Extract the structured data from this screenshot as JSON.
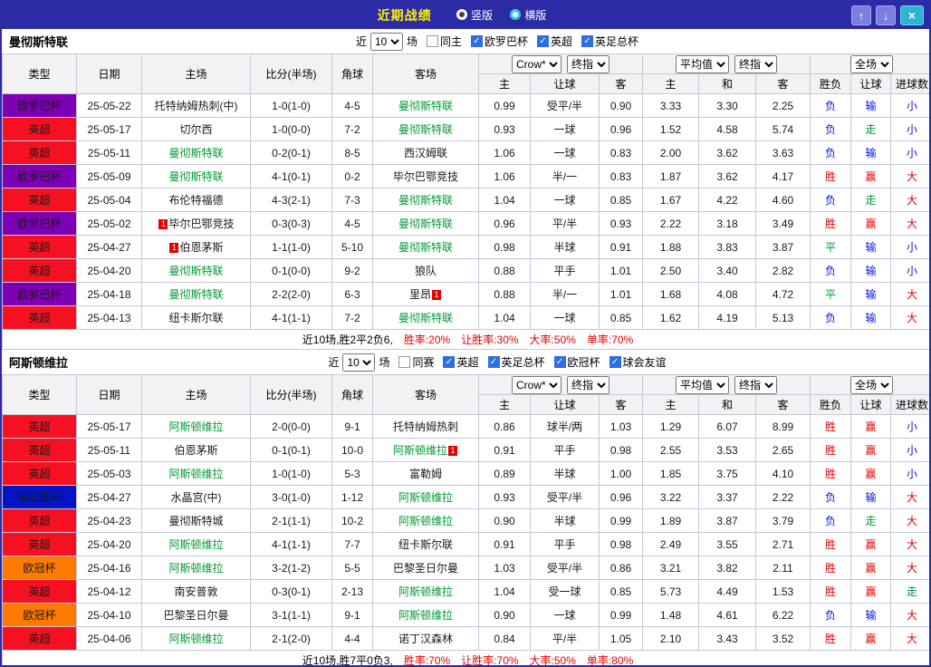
{
  "titlebar": {
    "title": "近期战绩",
    "vertical_label": "竖版",
    "horizontal_label": "横版",
    "up_icon": "↑",
    "down_icon": "↓",
    "close_icon": "×"
  },
  "filter_labels": {
    "near": "近",
    "games": "场"
  },
  "table_header": {
    "type": "类型",
    "date": "日期",
    "home": "主场",
    "score": "比分(半场)",
    "corner": "角球",
    "away": "客场",
    "odds1_select": "Crow*",
    "odds1_stage": "终指",
    "odds2_select": "平均值",
    "odds2_stage": "终指",
    "fulltime_select": "全场",
    "sub": [
      "主",
      "让球",
      "客",
      "主",
      "和",
      "客",
      "胜负",
      "让球",
      "进球数"
    ]
  },
  "colors": {
    "titlebar_bg": "#2b2ba6",
    "titlebar_title": "#ffef00",
    "nav_button": "#7d7de0",
    "close_button": "#2fb3cf",
    "checkbox_checked": "#2b6fe0",
    "grid_border": "#c6c6de",
    "header_bg": "#f2f2f2",
    "focal_team": "#009933",
    "score": "#dd2200",
    "type_map": {
      "欧罗巴杯": "#7d00b5",
      "英超": "#f51122",
      "英足总杯": "#0014c3",
      "欧冠杯": "#ff7a00"
    },
    "result_map": {
      "胜": "#e60000",
      "赢": "#e60000",
      "大": "#e60000",
      "负": "#0012e6",
      "输": "#0012e6",
      "小": "#0012e6",
      "平": "#009933",
      "走": "#009933"
    }
  },
  "sections": [
    {
      "team": "曼彻斯特联",
      "count": "10",
      "filters": [
        {
          "label": "同主",
          "checked": false
        },
        {
          "label": "欧罗巴杯",
          "checked": true
        },
        {
          "label": "英超",
          "checked": true
        },
        {
          "label": "英足总杯",
          "checked": true
        }
      ],
      "rows": [
        {
          "type": "欧罗巴杯",
          "date": "25-05-22",
          "home": {
            "name": "托特纳姆热刺(中)"
          },
          "score": "1-0(1-0)",
          "corner": "4-5",
          "away": {
            "name": "曼彻斯特联",
            "focal": true
          },
          "o1": [
            "0.99",
            "受平/半",
            "0.90"
          ],
          "o2": [
            "3.33",
            "3.30",
            "2.25"
          ],
          "res": [
            "负",
            "输",
            "小"
          ]
        },
        {
          "type": "英超",
          "date": "25-05-17",
          "home": {
            "name": "切尔西"
          },
          "score": "1-0(0-0)",
          "corner": "7-2",
          "away": {
            "name": "曼彻斯特联",
            "focal": true
          },
          "o1": [
            "0.93",
            "一球",
            "0.96"
          ],
          "o2": [
            "1.52",
            "4.58",
            "5.74"
          ],
          "res": [
            "负",
            "走",
            "小"
          ]
        },
        {
          "type": "英超",
          "date": "25-05-11",
          "home": {
            "name": "曼彻斯特联",
            "focal": true
          },
          "score": "0-2(0-1)",
          "corner": "8-5",
          "away": {
            "name": "西汉姆联"
          },
          "o1": [
            "1.06",
            "一球",
            "0.83"
          ],
          "o2": [
            "2.00",
            "3.62",
            "3.63"
          ],
          "res": [
            "负",
            "输",
            "小"
          ]
        },
        {
          "type": "欧罗巴杯",
          "date": "25-05-09",
          "home": {
            "name": "曼彻斯特联",
            "focal": true
          },
          "score": "4-1(0-1)",
          "corner": "0-2",
          "away": {
            "name": "毕尔巴鄂竞技"
          },
          "o1": [
            "1.06",
            "半/一",
            "0.83"
          ],
          "o2": [
            "1.87",
            "3.62",
            "4.17"
          ],
          "res": [
            "胜",
            "赢",
            "大"
          ]
        },
        {
          "type": "英超",
          "date": "25-05-04",
          "home": {
            "name": "布伦特福德"
          },
          "score": "4-3(2-1)",
          "corner": "7-3",
          "away": {
            "name": "曼彻斯特联",
            "focal": true
          },
          "o1": [
            "1.04",
            "一球",
            "0.85"
          ],
          "o2": [
            "1.67",
            "4.22",
            "4.60"
          ],
          "res": [
            "负",
            "走",
            "大"
          ]
        },
        {
          "type": "欧罗巴杯",
          "date": "25-05-02",
          "home": {
            "name": "毕尔巴鄂竞技",
            "flag": "1",
            "flagPos": "before"
          },
          "score": "0-3(0-3)",
          "corner": "4-5",
          "away": {
            "name": "曼彻斯特联",
            "focal": true
          },
          "o1": [
            "0.96",
            "平/半",
            "0.93"
          ],
          "o2": [
            "2.22",
            "3.18",
            "3.49"
          ],
          "res": [
            "胜",
            "赢",
            "大"
          ]
        },
        {
          "type": "英超",
          "date": "25-04-27",
          "home": {
            "name": "伯恩茅斯",
            "flag": "1",
            "flagPos": "before"
          },
          "score": "1-1(1-0)",
          "corner": "5-10",
          "away": {
            "name": "曼彻斯特联",
            "focal": true
          },
          "o1": [
            "0.98",
            "半球",
            "0.91"
          ],
          "o2": [
            "1.88",
            "3.83",
            "3.87"
          ],
          "res": [
            "平",
            "输",
            "小"
          ]
        },
        {
          "type": "英超",
          "date": "25-04-20",
          "home": {
            "name": "曼彻斯特联",
            "focal": true
          },
          "score": "0-1(0-0)",
          "corner": "9-2",
          "away": {
            "name": "狼队"
          },
          "o1": [
            "0.88",
            "平手",
            "1.01"
          ],
          "o2": [
            "2.50",
            "3.40",
            "2.82"
          ],
          "res": [
            "负",
            "输",
            "小"
          ]
        },
        {
          "type": "欧罗巴杯",
          "date": "25-04-18",
          "home": {
            "name": "曼彻斯特联",
            "focal": true
          },
          "score": "2-2(2-0)",
          "corner": "6-3",
          "away": {
            "name": "里昂",
            "flag": "1",
            "flagPos": "after"
          },
          "o1": [
            "0.88",
            "半/一",
            "1.01"
          ],
          "o2": [
            "1.68",
            "4.08",
            "4.72"
          ],
          "res": [
            "平",
            "输",
            "大"
          ]
        },
        {
          "type": "英超",
          "date": "25-04-13",
          "home": {
            "name": "纽卡斯尔联"
          },
          "score": "4-1(1-1)",
          "corner": "7-2",
          "away": {
            "name": "曼彻斯特联",
            "focal": true
          },
          "o1": [
            "1.04",
            "一球",
            "0.85"
          ],
          "o2": [
            "1.62",
            "4.19",
            "5.13"
          ],
          "res": [
            "负",
            "输",
            "大"
          ]
        }
      ],
      "summary": {
        "prefix": "近10场,胜2平2负6,",
        "stats": [
          "胜率:20%",
          "让胜率:30%",
          "大率:50%",
          "单率:70%"
        ]
      }
    },
    {
      "team": "阿斯顿维拉",
      "count": "10",
      "filters": [
        {
          "label": "同赛",
          "checked": false
        },
        {
          "label": "英超",
          "checked": true
        },
        {
          "label": "英足总杯",
          "checked": true
        },
        {
          "label": "欧冠杯",
          "checked": true
        },
        {
          "label": "球会友谊",
          "checked": true
        }
      ],
      "rows": [
        {
          "type": "英超",
          "date": "25-05-17",
          "home": {
            "name": "阿斯顿维拉",
            "focal": true
          },
          "score": "2-0(0-0)",
          "corner": "9-1",
          "away": {
            "name": "托特纳姆热刺"
          },
          "o1": [
            "0.86",
            "球半/两",
            "1.03"
          ],
          "o2": [
            "1.29",
            "6.07",
            "8.99"
          ],
          "res": [
            "胜",
            "赢",
            "小"
          ]
        },
        {
          "type": "英超",
          "date": "25-05-11",
          "home": {
            "name": "伯恩茅斯"
          },
          "score": "0-1(0-1)",
          "corner": "10-0",
          "away": {
            "name": "阿斯顿维拉",
            "focal": true,
            "flag": "1",
            "flagPos": "after"
          },
          "o1": [
            "0.91",
            "平手",
            "0.98"
          ],
          "o2": [
            "2.55",
            "3.53",
            "2.65"
          ],
          "res": [
            "胜",
            "赢",
            "小"
          ]
        },
        {
          "type": "英超",
          "date": "25-05-03",
          "home": {
            "name": "阿斯顿维拉",
            "focal": true
          },
          "score": "1-0(1-0)",
          "corner": "5-3",
          "away": {
            "name": "富勒姆"
          },
          "o1": [
            "0.89",
            "半球",
            "1.00"
          ],
          "o2": [
            "1.85",
            "3.75",
            "4.10"
          ],
          "res": [
            "胜",
            "赢",
            "小"
          ]
        },
        {
          "type": "英足总杯",
          "date": "25-04-27",
          "home": {
            "name": "水晶宫(中)"
          },
          "score": "3-0(1-0)",
          "corner": "1-12",
          "away": {
            "name": "阿斯顿维拉",
            "focal": true
          },
          "o1": [
            "0.93",
            "受平/半",
            "0.96"
          ],
          "o2": [
            "3.22",
            "3.37",
            "2.22"
          ],
          "res": [
            "负",
            "输",
            "大"
          ]
        },
        {
          "type": "英超",
          "date": "25-04-23",
          "home": {
            "name": "曼彻斯特城"
          },
          "score": "2-1(1-1)",
          "corner": "10-2",
          "away": {
            "name": "阿斯顿维拉",
            "focal": true
          },
          "o1": [
            "0.90",
            "半球",
            "0.99"
          ],
          "o2": [
            "1.89",
            "3.87",
            "3.79"
          ],
          "res": [
            "负",
            "走",
            "大"
          ]
        },
        {
          "type": "英超",
          "date": "25-04-20",
          "home": {
            "name": "阿斯顿维拉",
            "focal": true
          },
          "score": "4-1(1-1)",
          "corner": "7-7",
          "away": {
            "name": "纽卡斯尔联"
          },
          "o1": [
            "0.91",
            "平手",
            "0.98"
          ],
          "o2": [
            "2.49",
            "3.55",
            "2.71"
          ],
          "res": [
            "胜",
            "赢",
            "大"
          ]
        },
        {
          "type": "欧冠杯",
          "date": "25-04-16",
          "home": {
            "name": "阿斯顿维拉",
            "focal": true
          },
          "score": "3-2(1-2)",
          "corner": "5-5",
          "away": {
            "name": "巴黎圣日尔曼"
          },
          "o1": [
            "1.03",
            "受平/半",
            "0.86"
          ],
          "o2": [
            "3.21",
            "3.82",
            "2.11"
          ],
          "res": [
            "胜",
            "赢",
            "大"
          ]
        },
        {
          "type": "英超",
          "date": "25-04-12",
          "home": {
            "name": "南安普敦"
          },
          "score": "0-3(0-1)",
          "corner": "2-13",
          "away": {
            "name": "阿斯顿维拉",
            "focal": true
          },
          "o1": [
            "1.04",
            "受一球",
            "0.85"
          ],
          "o2": [
            "5.73",
            "4.49",
            "1.53"
          ],
          "res": [
            "胜",
            "赢",
            "走"
          ]
        },
        {
          "type": "欧冠杯",
          "date": "25-04-10",
          "home": {
            "name": "巴黎圣日尔曼"
          },
          "score": "3-1(1-1)",
          "corner": "9-1",
          "away": {
            "name": "阿斯顿维拉",
            "focal": true
          },
          "o1": [
            "0.90",
            "一球",
            "0.99"
          ],
          "o2": [
            "1.48",
            "4.61",
            "6.22"
          ],
          "res": [
            "负",
            "输",
            "大"
          ]
        },
        {
          "type": "英超",
          "date": "25-04-06",
          "home": {
            "name": "阿斯顿维拉",
            "focal": true
          },
          "score": "2-1(2-0)",
          "corner": "4-4",
          "away": {
            "name": "诺丁汉森林"
          },
          "o1": [
            "0.84",
            "平/半",
            "1.05"
          ],
          "o2": [
            "2.10",
            "3.43",
            "3.52"
          ],
          "res": [
            "胜",
            "赢",
            "大"
          ]
        }
      ],
      "summary": {
        "prefix": "近10场,胜7平0负3,",
        "stats": [
          "胜率:70%",
          "让胜率:70%",
          "大率:50%",
          "单率:80%"
        ]
      }
    }
  ]
}
